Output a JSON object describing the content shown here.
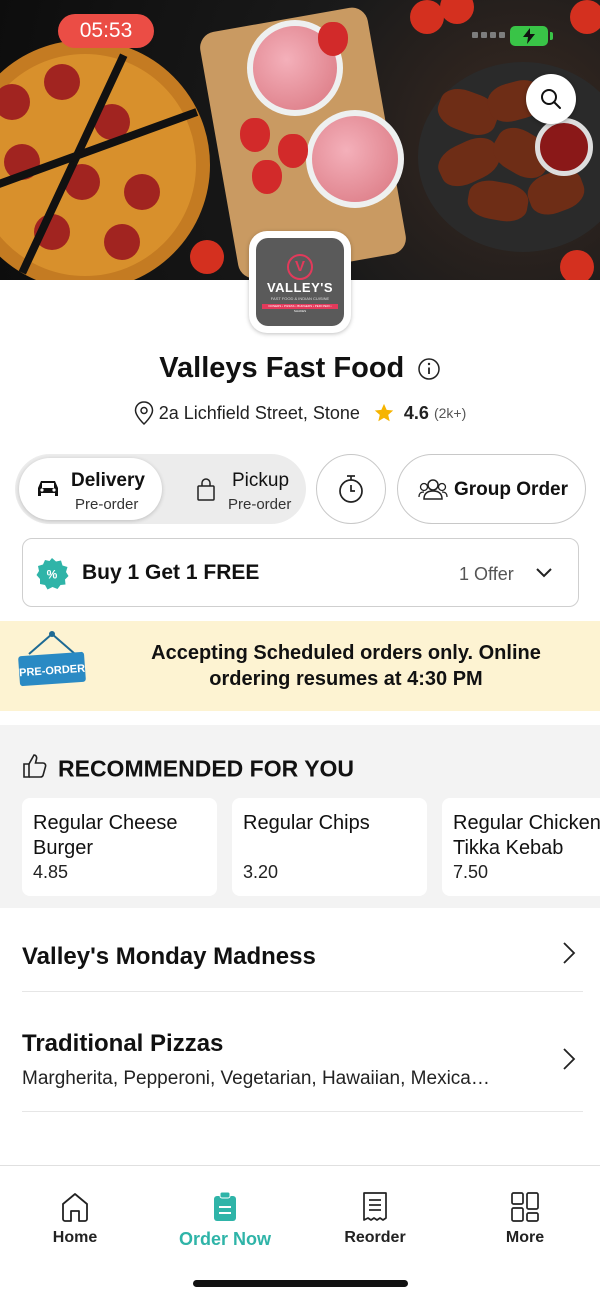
{
  "status_bar": {
    "time": "05:53",
    "battery_color": "#39c447"
  },
  "restaurant": {
    "name": "Valleys Fast Food",
    "address": "2a Lichfield Street, Stone",
    "rating": "4.6",
    "rating_count": "(2k+)",
    "logo": {
      "name": "VALLEY'S",
      "tagline": "FAST FOOD & INDIAN CUISINE",
      "strip": "DONERS • PIZZAS • BURGERS • PERI PERI • SHAKES"
    }
  },
  "order_modes": {
    "delivery": {
      "label": "Delivery",
      "sub": "Pre-order"
    },
    "pickup": {
      "label": "Pickup",
      "sub": "Pre-order"
    }
  },
  "group_order_label": "Group Order",
  "offer": {
    "title": "Buy 1 Get 1 FREE",
    "count": "1 Offer"
  },
  "banner": {
    "sign": "PRE-ORDER",
    "text": "Accepting Scheduled orders only. Online ordering resumes at 4:30 PM"
  },
  "recommended": {
    "heading": "RECOMMENDED FOR YOU",
    "items": [
      {
        "name": "Regular Cheese\nBurger",
        "price": "4.85"
      },
      {
        "name": "Regular Chips",
        "price": "3.20"
      },
      {
        "name": "Regular Chicken\nTikka Kebab",
        "price": "7.50"
      }
    ]
  },
  "categories": [
    {
      "title": "Valley's Monday Madness",
      "desc": ""
    },
    {
      "title": "Traditional Pizzas",
      "desc": "Margherita, Pepperoni, Vegetarian, Hawaiian, Mexica…"
    }
  ],
  "nav": {
    "items": [
      {
        "label": "Home",
        "icon": "home-icon"
      },
      {
        "label": "Order Now",
        "icon": "order-icon"
      },
      {
        "label": "Reorder",
        "icon": "receipt-icon"
      },
      {
        "label": "More",
        "icon": "grid-icon"
      }
    ],
    "active_color": "#2fb4a8"
  },
  "colors": {
    "accent": "#2fb4a8",
    "banner_bg": "#fdf3d2",
    "status_red": "#eb4d45",
    "star": "#f6b400"
  }
}
